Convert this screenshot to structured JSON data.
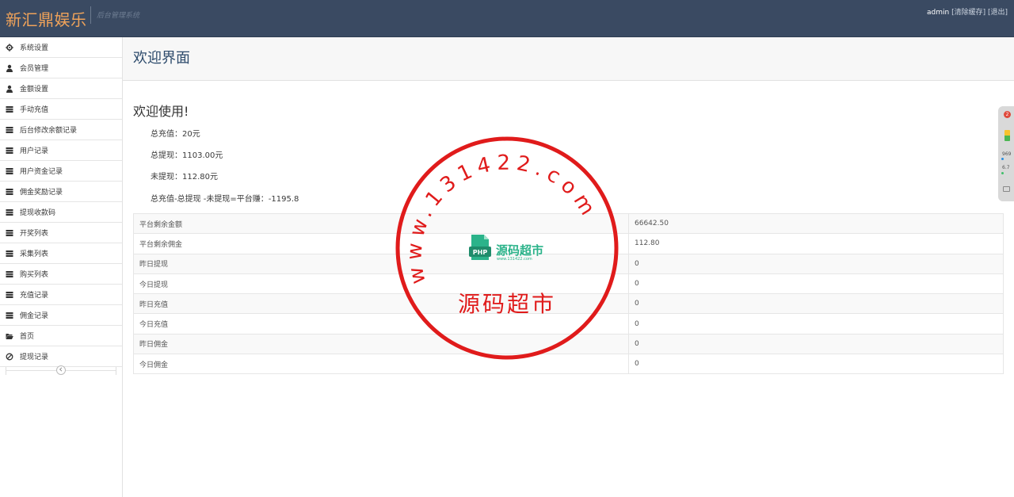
{
  "navbar": {
    "brand": "新汇鼎娱乐",
    "subtitle": "后台管理系统",
    "user": "admin",
    "clear_cache": "[清除缓存]",
    "logout": "[退出]"
  },
  "sidebar": {
    "items": [
      {
        "label": "系统设置",
        "icon": "gear-icon"
      },
      {
        "label": "会员管理",
        "icon": "user-icon"
      },
      {
        "label": "金额设置",
        "icon": "user-icon"
      },
      {
        "label": "手动充值",
        "icon": "list-icon"
      },
      {
        "label": "后台修改余额记录",
        "icon": "list-icon"
      },
      {
        "label": "用户记录",
        "icon": "list-icon"
      },
      {
        "label": "用户资金记录",
        "icon": "list-icon"
      },
      {
        "label": "佣金奖励记录",
        "icon": "list-icon"
      },
      {
        "label": "提现收款码",
        "icon": "list-icon"
      },
      {
        "label": "开奖列表",
        "icon": "list-icon"
      },
      {
        "label": "采集列表",
        "icon": "list-icon"
      },
      {
        "label": "购买列表",
        "icon": "list-icon"
      },
      {
        "label": "充值记录",
        "icon": "list-icon"
      },
      {
        "label": "佣金记录",
        "icon": "list-icon"
      },
      {
        "label": "首页",
        "icon": "folder-open-icon"
      },
      {
        "label": "提现记录",
        "icon": "ban-icon"
      }
    ]
  },
  "main": {
    "page_title": "欢迎界面",
    "welcome": "欢迎使用!",
    "summary": [
      "总充值：20元",
      "总提现：1103.00元",
      "未提现：112.80元",
      "总充值-总提现 -未提现=平台赚：-1195.8"
    ],
    "table": [
      {
        "label": "平台剩余金额",
        "value": "66642.50"
      },
      {
        "label": "平台剩余佣金",
        "value": "112.80"
      },
      {
        "label": "昨日提现",
        "value": "0"
      },
      {
        "label": "今日提现",
        "value": "0"
      },
      {
        "label": "昨日充值",
        "value": "0"
      },
      {
        "label": "今日充值",
        "value": "0"
      },
      {
        "label": "昨日佣金",
        "value": "0"
      },
      {
        "label": "今日佣金",
        "value": "0"
      }
    ]
  },
  "widget": {
    "badge": "2",
    "num1": "969",
    "num2": "6.7"
  },
  "watermark": {
    "ring_text": "www.131422.com",
    "bottom_text": "源码超市",
    "logo_text": "源码超市",
    "logo_badge": "PHP",
    "logo_url": "www.131422.com"
  },
  "colors": {
    "navbar_bg": "#3a4a62",
    "brand": "#f0a35a",
    "stamp_red": "#e01b1b",
    "logo_green": "#2bb38a"
  }
}
